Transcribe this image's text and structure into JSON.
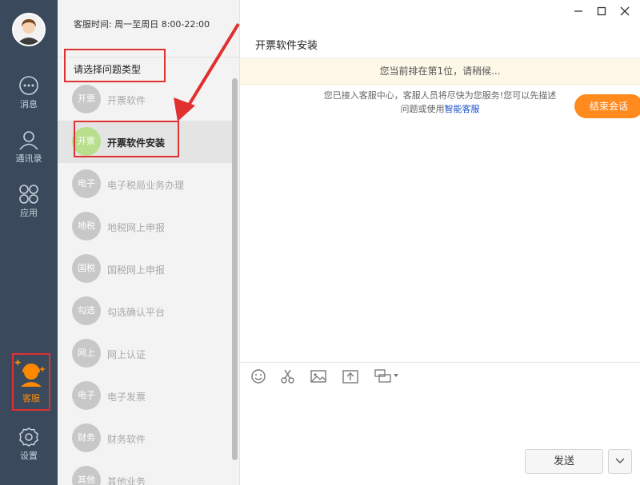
{
  "rail": {
    "items": [
      {
        "label": "消息"
      },
      {
        "label": "通讯录"
      },
      {
        "label": "应用"
      },
      {
        "label": "客服"
      },
      {
        "label": "设置"
      }
    ]
  },
  "list": {
    "service_hours": "客服时间: 周一至周日 8:00-22:00",
    "prompt": "请选择问题类型",
    "categories": [
      {
        "badge": "开票",
        "name": "开票软件"
      },
      {
        "badge": "开票",
        "name": "开票软件安装"
      },
      {
        "badge": "电子",
        "name": "电子税局业务办理"
      },
      {
        "badge": "地税",
        "name": "地税网上申报"
      },
      {
        "badge": "国税",
        "name": "国税网上申报"
      },
      {
        "badge": "勾选",
        "name": "勾选确认平台"
      },
      {
        "badge": "网上",
        "name": "网上认证"
      },
      {
        "badge": "电子",
        "name": "电子发票"
      },
      {
        "badge": "财务",
        "name": "财务软件"
      },
      {
        "badge": "其他",
        "name": "其他业务"
      }
    ],
    "selected_index": 1
  },
  "chat": {
    "title": "开票软件安装",
    "queue_notice": "您当前排在第1位，请稍候...",
    "system_message_line1": "您已接入客服中心，客服人员将尽快为您服务!您可以先描述",
    "system_message_line2_prefix": "问题或使用",
    "system_message_link": "智能客服",
    "end_button": "结束会话",
    "send_button": "发送"
  },
  "icons": {
    "window_controls": [
      "minimize-icon",
      "maximize-icon",
      "close-icon"
    ],
    "toolbar": [
      "emoji-icon",
      "scissors-icon",
      "image-icon",
      "upload-icon",
      "screenshot-icon"
    ]
  },
  "colors": {
    "rail_bg": "#3a4a5c",
    "accent_orange": "#ff8a1e",
    "highlight_red": "#e03030",
    "selected_badge_green": "#b9df8c",
    "link_blue": "#1a4fc9"
  }
}
